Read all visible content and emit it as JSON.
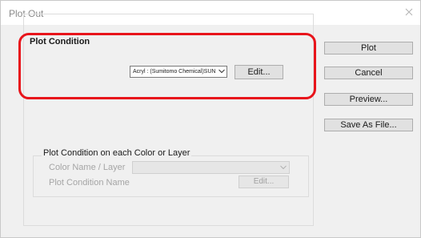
{
  "window": {
    "title": "Plot Out"
  },
  "plot_condition": {
    "group_label": "Plot Condition",
    "material_select": {
      "selected": "Acryl : (Sumitomo Chemical)SUN"
    },
    "edit_label": "Edit..."
  },
  "actions": {
    "plot_label": "Plot",
    "cancel_label": "Cancel",
    "preview_label": "Preview...",
    "save_as_file_label": "Save As File..."
  },
  "layer_condition": {
    "group_label": "Plot Condition on each Color or Layer",
    "color_name_label": "Color Name / Layer",
    "color_name_value": "",
    "plot_condition_name_label": "Plot Condition Name",
    "edit_label": "Edit..."
  },
  "colors": {
    "highlight": "#e8141b",
    "background": "#f0f0f0",
    "button_face": "#e1e1e1",
    "disabled_text": "#a5a5a5"
  },
  "icons": {
    "close": "close-icon",
    "dropdown": "chevron-down-icon"
  }
}
